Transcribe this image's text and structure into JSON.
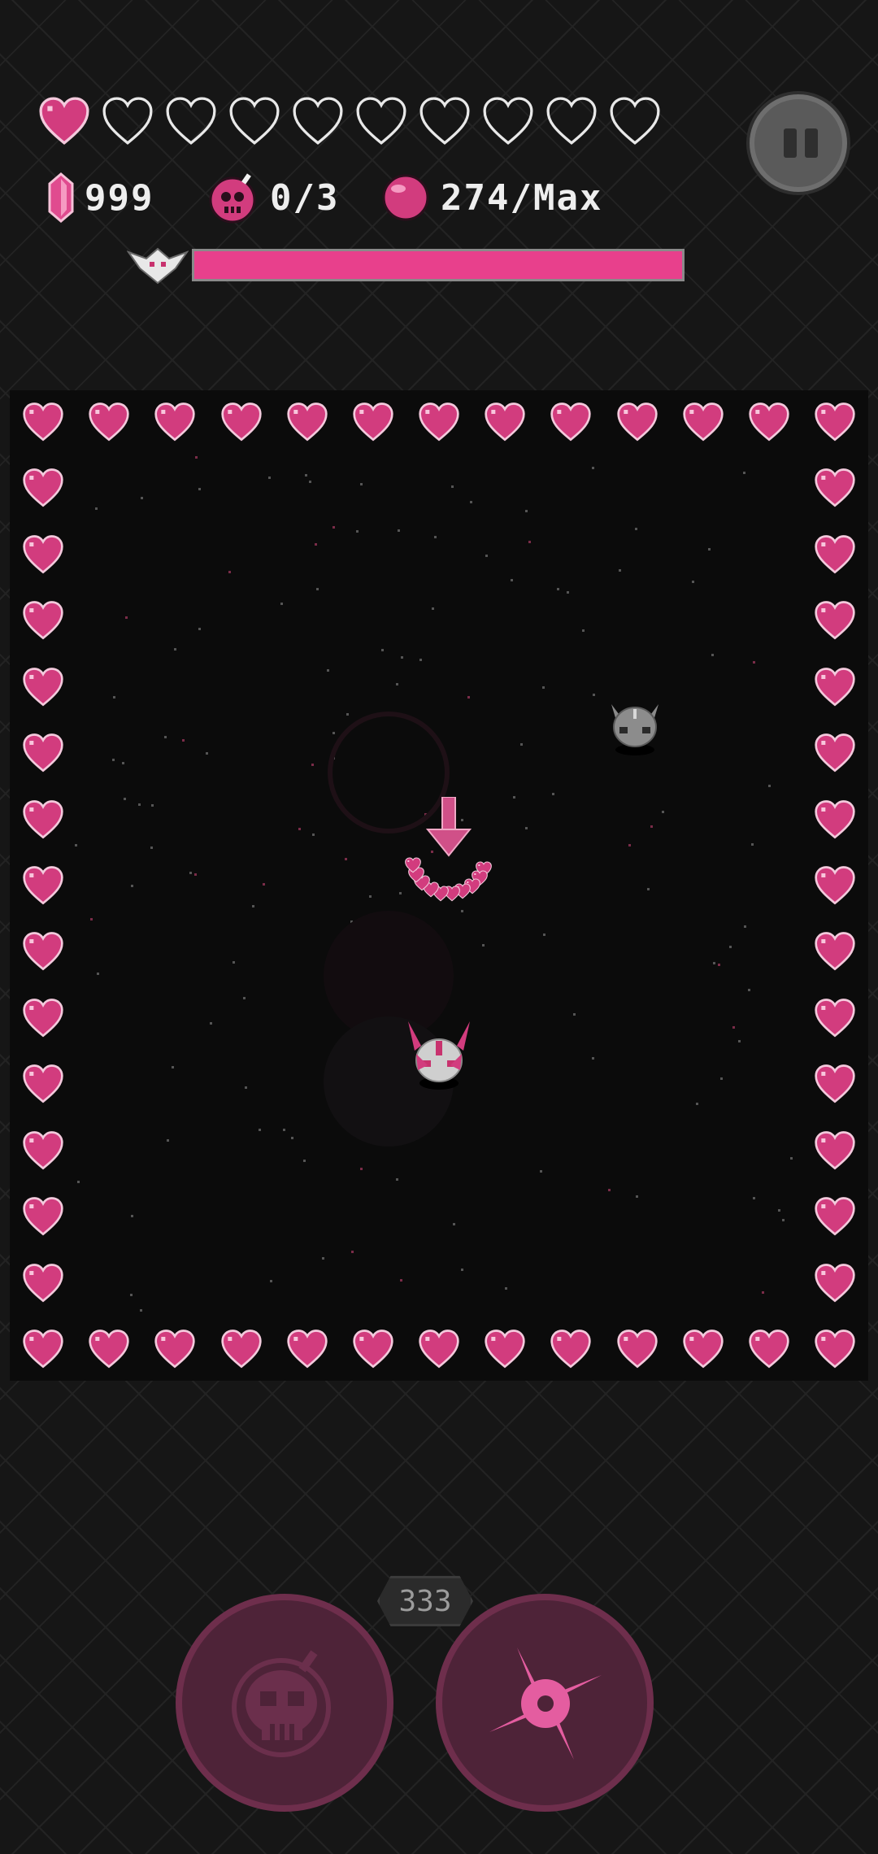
{
  "hud": {
    "health": {
      "current": 1,
      "max": 10
    },
    "gems": {
      "value": "999",
      "icon": "pink-crystal-icon"
    },
    "bombs": {
      "value": "0/3",
      "icon": "skull-bomb-icon"
    },
    "orbs": {
      "value": "274/Max",
      "icon": "pink-orb-icon"
    },
    "boss": {
      "icon": "winged-boss-icon",
      "health_fraction": 1.0
    },
    "pause": {
      "icon": "pause-icon"
    }
  },
  "arena": {
    "border_icon": "heart-icon",
    "entities": [
      {
        "name": "player-ship",
        "icon": "horned-pink-skull-icon"
      },
      {
        "name": "enemy-gray-skull",
        "icon": "gray-skull-icon"
      },
      {
        "name": "pink-arrow-projectile",
        "icon": "down-arrow-icon"
      },
      {
        "name": "heart-ring",
        "icon": "small-heart-icon"
      }
    ]
  },
  "controls": {
    "bomb_button": {
      "icon": "skull-bomb-icon"
    },
    "ability_button": {
      "icon": "shuriken-icon"
    },
    "ability_counter": "333"
  },
  "colors": {
    "accent_pink": "#e8408c",
    "heart_pink": "#d23c7e",
    "empty_heart_outline": "#e8e8e8",
    "background": "#161616",
    "arena_bg": "#0b0b0b",
    "button_fill": "#4e2338"
  }
}
